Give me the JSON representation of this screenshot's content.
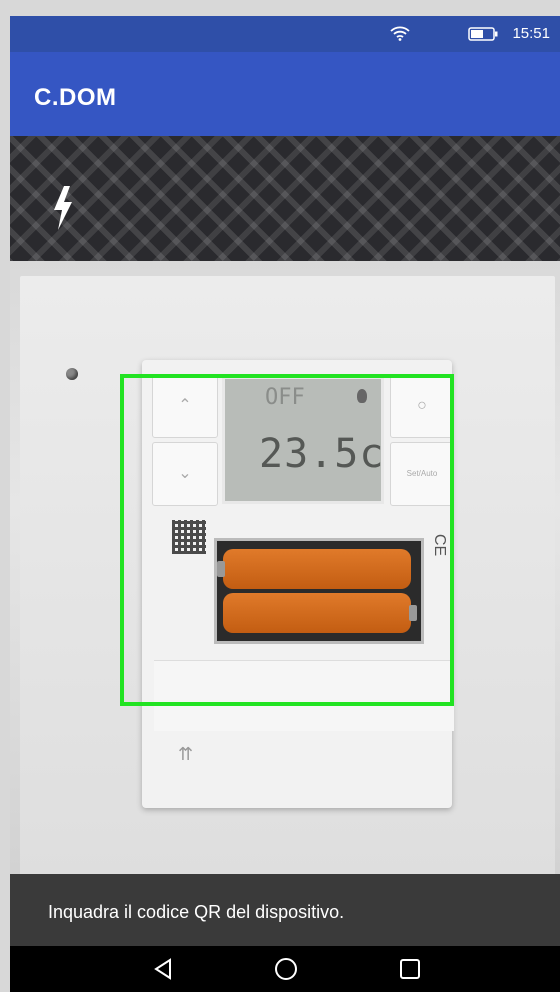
{
  "status_bar": {
    "time": "15:51",
    "wifi_icon": "wifi-icon",
    "battery_icon": "battery-icon"
  },
  "app_bar": {
    "title": "C.DOM"
  },
  "camera": {
    "flash_icon": "flash-icon",
    "device_display": {
      "mode": "OFF",
      "temperature": "23.5c"
    },
    "scan_frame_color": "#22e322"
  },
  "hint": {
    "text": "Inquadra il codice QR del dispositivo."
  },
  "navigation": {
    "back_icon": "back-triangle-icon",
    "home_icon": "home-circle-icon",
    "recents_icon": "recents-square-icon"
  },
  "colors": {
    "status_bar": "#2f4fa8",
    "app_bar": "#3556c3",
    "hint_bar": "#3a3a3a",
    "nav_bar": "#000000"
  }
}
